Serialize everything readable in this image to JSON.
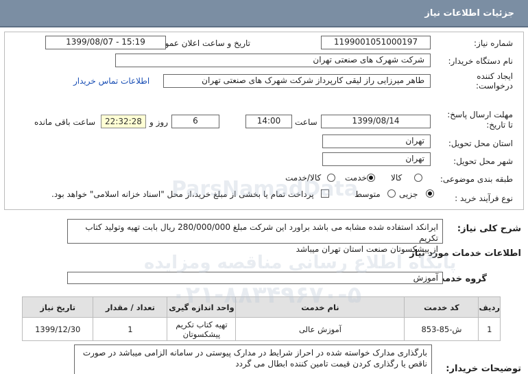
{
  "header": {
    "title": "جزئیات اطلاعات نیاز"
  },
  "fields": {
    "need_number_label": "شماره نیاز:",
    "need_number": "1199001051000197",
    "announce_label": "تاریخ و ساعت اعلان عمومی:",
    "announce_value": "1399/08/07 - 15:19",
    "buyer_org_label": "نام دستگاه خریدار:",
    "buyer_org": "شرکت شهرک های صنعتی تهران",
    "creator_label_1": "ایجاد کننده",
    "creator_label_2": "درخواست:",
    "creator": "طاهر  میرزایی راز لیقی کارپرداز  شرکت شهرک های صنعتی تهران",
    "contact_link": "اطلاعات تماس خریدار",
    "deadline_label_1": "مهلت ارسال پاسخ:",
    "deadline_label_2": "تا تاریخ:",
    "deadline_date": "1399/08/14",
    "time_label": "ساعت",
    "deadline_time": "14:00",
    "days_value": "6",
    "days_label": "روز و",
    "remaining_time": "22:32:28",
    "remaining_label": "ساعت باقی مانده",
    "province_label": "استان محل تحویل:",
    "province": "تهران",
    "city_label": "شهر محل تحویل:",
    "city": "تهران",
    "category_label": "طبقه بندی موضوعی:",
    "category_options": [
      "کالا",
      "خدمت",
      "کالا/خدمت"
    ],
    "category_selected": "خدمت",
    "process_label": "نوع فرآیند خرید :",
    "process_options": [
      "جزیی",
      "متوسط"
    ],
    "process_selected": "جزیی",
    "payment_note": "پرداخت تمام یا بخشی از مبلغ خرید،از محل \"اسناد خزانه اسلامی\" خواهد بود."
  },
  "summary": {
    "label": "شرح کلی نیاز:",
    "text_line1": "ایرانکد استفاده شده مشابه می باشد براورد این شرکت مبلغ 280/000/000 ریال بابت تهیه وتولید کتاب تکریم",
    "text_line2": "از پیشکسوتان صنعت استان تهران میباشد"
  },
  "services_section": {
    "title": "اطلاعات خدمات مورد نیاز"
  },
  "service_group": {
    "label": "گروه خدمت:",
    "value": "آموزش"
  },
  "table": {
    "headers": [
      "ردیف",
      "کد خدمت",
      "نام خدمت",
      "واحد اندازه گیری",
      "تعداد / مقدار",
      "تاریخ نیاز"
    ],
    "rows": [
      {
        "row": "1",
        "code": "ش-85-853",
        "name": "آموزش عالی",
        "unit_1": "تهیه کتاب تکریم",
        "unit_2": "پیشکسوتان",
        "qty": "1",
        "date": "1399/12/30"
      }
    ]
  },
  "notes": {
    "label": "توضیحات خریدار:",
    "line1": "بارگذاری مدارک خواسته شده در احراز شرایط در مدارک پیوستی در سامانه الزامی میباشد در صورت",
    "line2": "ناقص یا رگذاری کردن قیمت تامین کننده ابطال می گردد"
  },
  "watermark": {
    "brand": "ParsNamadData",
    "line1": "پایگاه اطلاع رسانی مناقصه ومزایده",
    "phone": "۰۲۱-۸۸۳۴۹۶۷۰-۵"
  },
  "colors": {
    "header_bg": "#7b8ea3",
    "link": "#1a4fb5",
    "timer_bg": "#ffffd4"
  }
}
